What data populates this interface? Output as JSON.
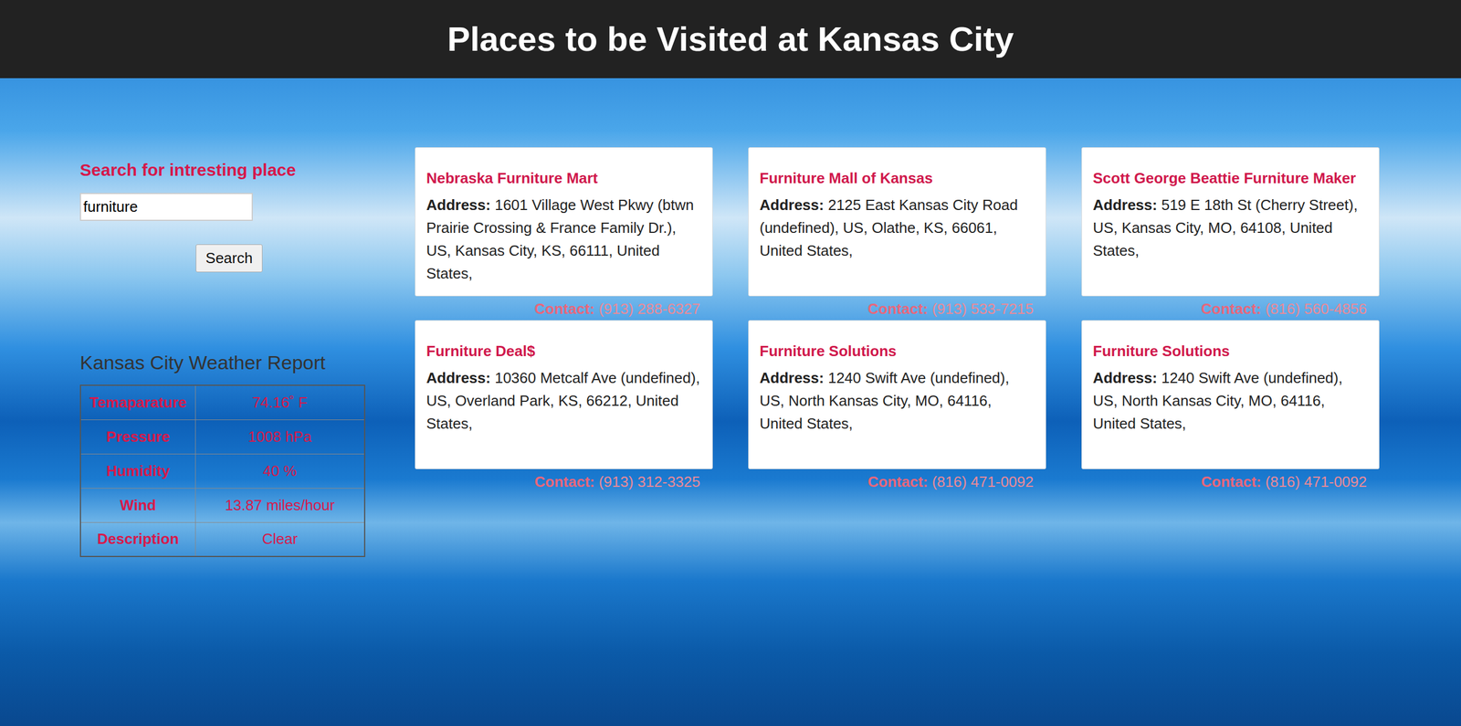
{
  "header": {
    "title": "Places to be Visited at Kansas City"
  },
  "search": {
    "heading": "Search for intresting place",
    "value": "furniture",
    "button": "Search"
  },
  "weather": {
    "title": "Kansas City Weather Report",
    "rows": [
      {
        "label": "Temaparature",
        "value": "74.16˚ F"
      },
      {
        "label": "Pressure",
        "value": "1008 hPa"
      },
      {
        "label": "Humidity",
        "value": "40 %"
      },
      {
        "label": "Wind",
        "value": "13.87 miles/hour"
      },
      {
        "label": "Description",
        "value": "Clear"
      }
    ]
  },
  "places": {
    "address_label": "Address:",
    "contact_label": "Contact:",
    "items": [
      {
        "name": "Nebraska Furniture Mart",
        "address": "1601 Village West Pkwy (btwn Prairie Crossing & France Family Dr.), US, Kansas City, KS, 66111, United States,",
        "phone": "(913) 288-6327"
      },
      {
        "name": "Furniture Mall of Kansas",
        "address": "2125 East Kansas City Road (undefined), US, Olathe, KS, 66061, United States,",
        "phone": "(913) 533-7215"
      },
      {
        "name": "Scott George Beattie Furniture Maker",
        "address": "519 E 18th St (Cherry Street), US, Kansas City, MO, 64108, United States,",
        "phone": "(816) 560-4856"
      },
      {
        "name": "Furniture Deal$",
        "address": "10360 Metcalf Ave (undefined), US, Overland Park, KS, 66212, United States,",
        "phone": "(913) 312-3325"
      },
      {
        "name": "Furniture Solutions",
        "address": "1240 Swift Ave (undefined), US, North Kansas City, MO, 64116, United States,",
        "phone": "(816) 471-0092"
      },
      {
        "name": "Furniture Solutions",
        "address": "1240 Swift Ave (undefined), US, North Kansas City, MO, 64116, United States,",
        "phone": "(816) 471-0092"
      }
    ]
  }
}
